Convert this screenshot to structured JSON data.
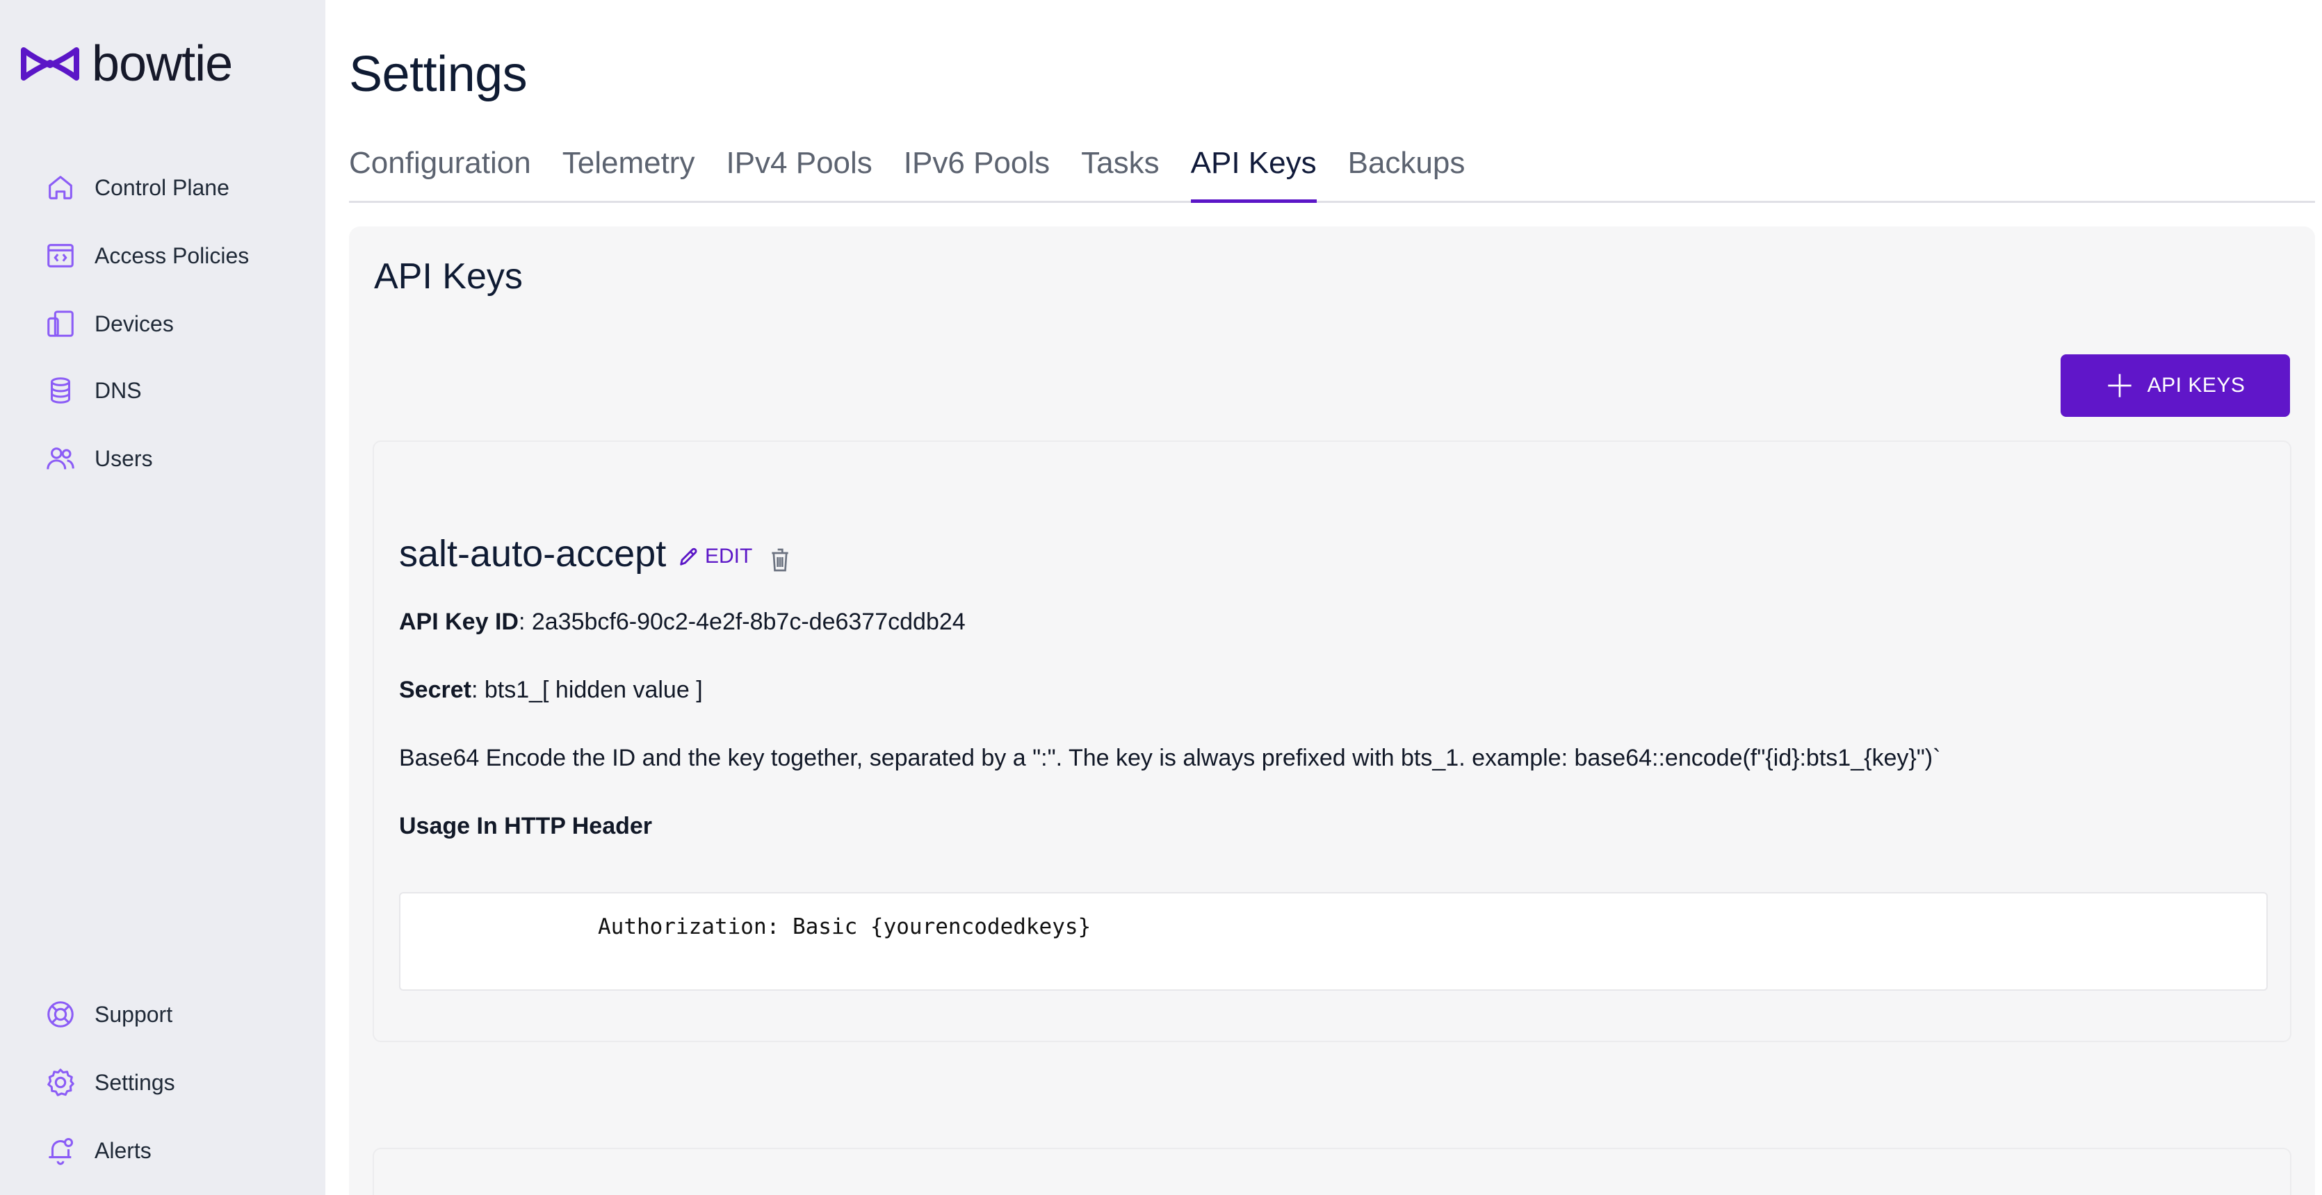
{
  "brand": {
    "name": "bowtie",
    "accent": "#5b16c7"
  },
  "sidebar": {
    "items": [
      {
        "label": "Control Plane",
        "icon": "home-icon"
      },
      {
        "label": "Access Policies",
        "icon": "code-window-icon"
      },
      {
        "label": "Devices",
        "icon": "devices-icon"
      },
      {
        "label": "DNS",
        "icon": "database-icon"
      },
      {
        "label": "Users",
        "icon": "users-icon"
      }
    ],
    "bottom_items": [
      {
        "label": "Support",
        "icon": "lifebuoy-icon"
      },
      {
        "label": "Settings",
        "icon": "gear-icon"
      },
      {
        "label": "Alerts",
        "icon": "bell-icon"
      }
    ]
  },
  "main": {
    "title": "Settings",
    "tabs": [
      {
        "label": "Configuration"
      },
      {
        "label": "Telemetry"
      },
      {
        "label": "IPv4 Pools"
      },
      {
        "label": "IPv6 Pools"
      },
      {
        "label": "Tasks"
      },
      {
        "label": "API Keys",
        "active": true
      },
      {
        "label": "Backups"
      }
    ],
    "panel": {
      "title": "API Keys",
      "add_button_label": "API KEYS",
      "key": {
        "name": "salt-auto-accept",
        "edit_label": "EDIT",
        "id_label": "API Key ID",
        "id_value": ": 2a35bcf6-90c2-4e2f-8b7c-de6377cddb24",
        "secret_label": "Secret",
        "secret_value": ": bts1_[ hidden value ]",
        "description": "Base64 Encode the ID and the key together, separated by a \":\". The key is always prefixed with bts_1. example: base64::encode(f\"{id}:bts1_{key}\")`",
        "usage_title": "Usage In HTTP Header",
        "usage_code": "Authorization: Basic {yourencodedkeys}"
      }
    }
  }
}
